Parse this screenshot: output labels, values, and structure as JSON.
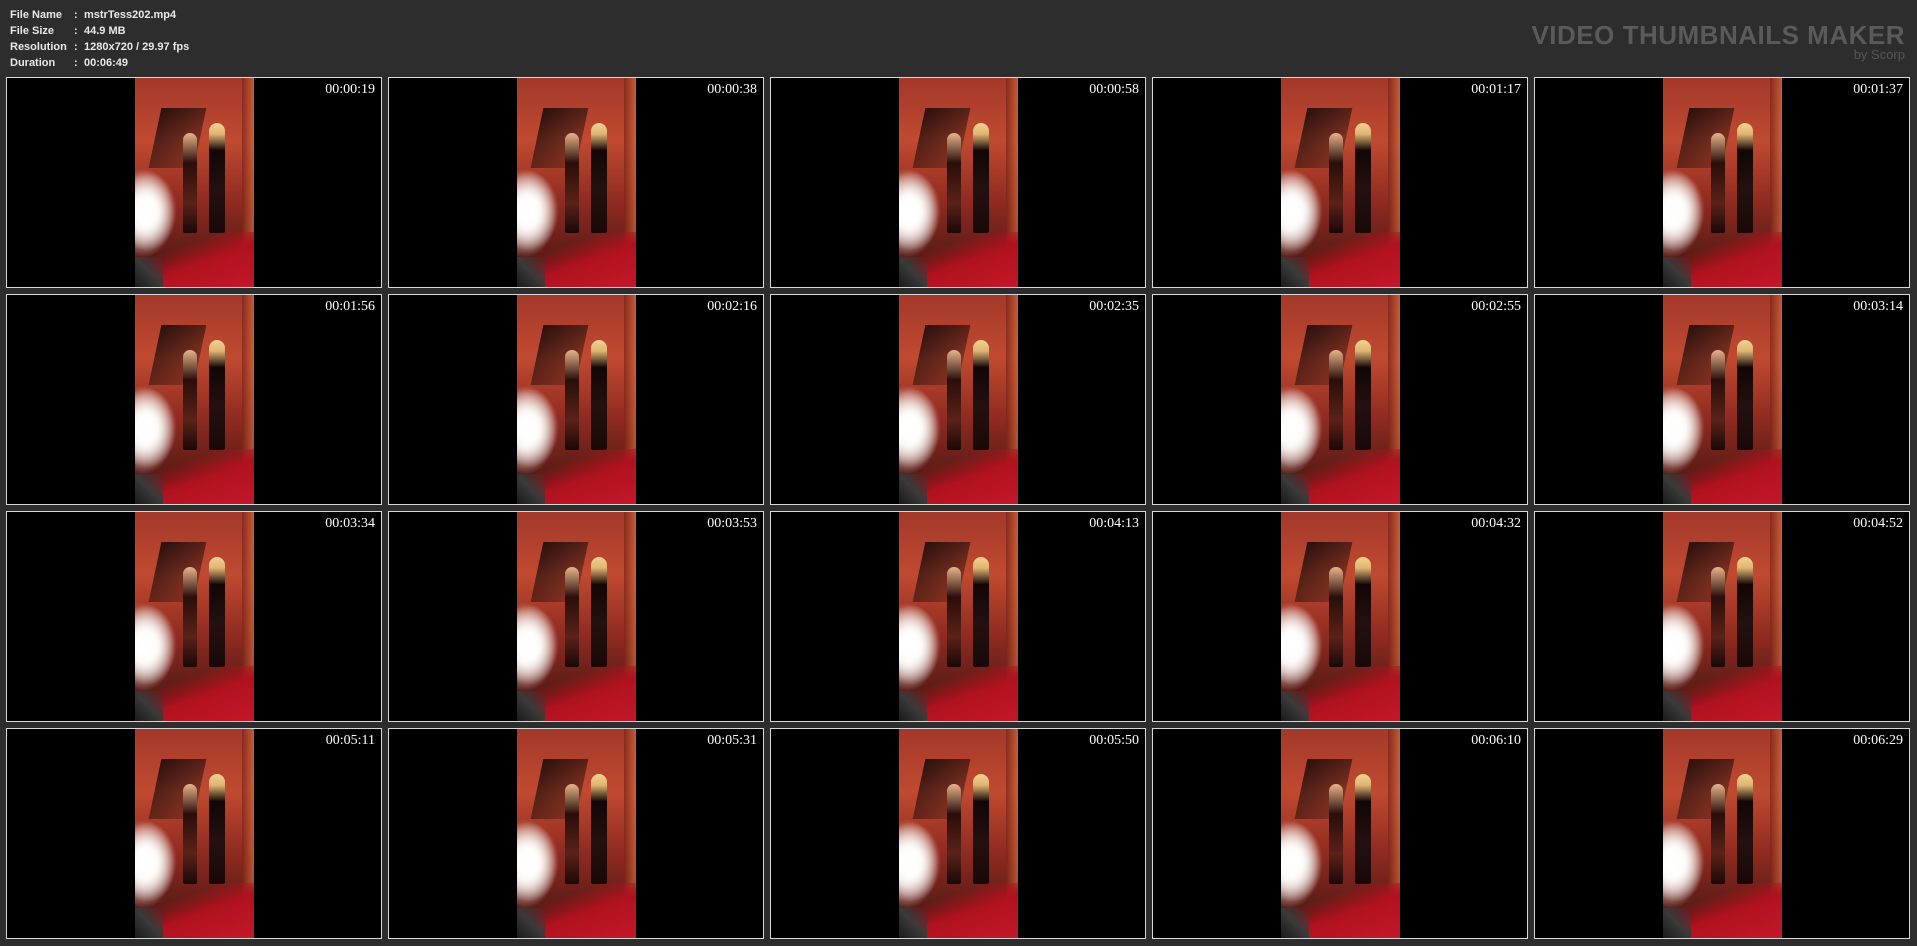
{
  "info": {
    "file_name_label": "File Name",
    "file_name": "mstrTess202.mp4",
    "file_size_label": "File Size",
    "file_size": "44.9 MB",
    "resolution_label": "Resolution",
    "resolution": "1280x720 / 29.97 fps",
    "duration_label": "Duration",
    "duration": "00:06:49",
    "separator": ":"
  },
  "logo": {
    "title": "VIDEO THUMBNAILS MAKER",
    "subtitle": "by Scorp"
  },
  "thumbnails": [
    "00:00:19",
    "00:00:38",
    "00:00:58",
    "00:01:17",
    "00:01:37",
    "00:01:56",
    "00:02:16",
    "00:02:35",
    "00:02:55",
    "00:03:14",
    "00:03:34",
    "00:03:53",
    "00:04:13",
    "00:04:32",
    "00:04:52",
    "00:05:11",
    "00:05:31",
    "00:05:50",
    "00:06:10",
    "00:06:29"
  ]
}
